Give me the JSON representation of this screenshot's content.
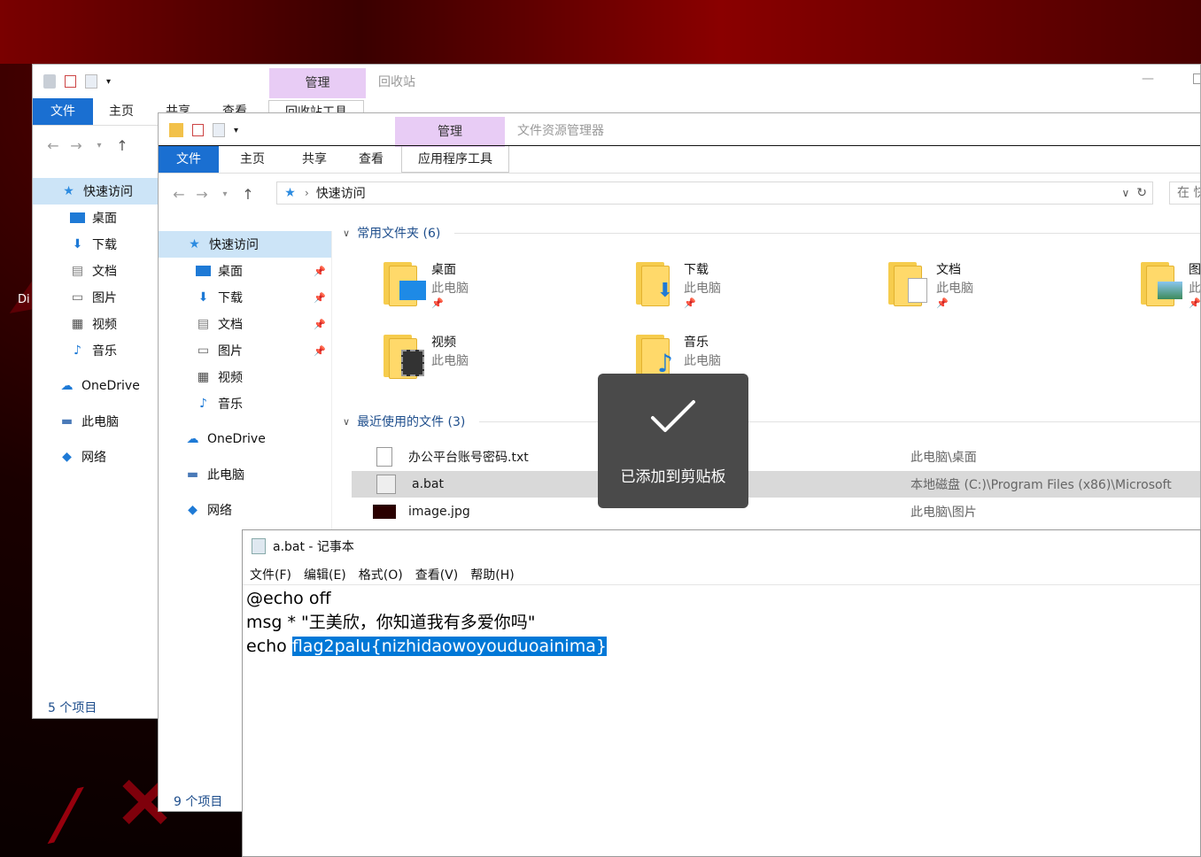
{
  "desktop": {
    "icon_label": "Di"
  },
  "back_window": {
    "context_tab": "管理",
    "title": "回收站",
    "tabs": [
      "文件",
      "主页",
      "共享",
      "查看"
    ],
    "context_sub_tab": "回收站工具",
    "nav": [
      "快速访问",
      "桌面",
      "下载",
      "文档",
      "图片",
      "视频",
      "音乐",
      "OneDrive",
      "此电脑",
      "网络"
    ],
    "status": "5 个项目"
  },
  "front_window": {
    "context_tab": "管理",
    "title": "文件资源管理器",
    "tabs": [
      "文件",
      "主页",
      "共享",
      "查看"
    ],
    "context_sub_tab": "应用程序工具",
    "address": "快速访问",
    "search_placeholder": "在 快",
    "nav": [
      "快速访问",
      "桌面",
      "下载",
      "文档",
      "图片",
      "视频",
      "音乐",
      "OneDrive",
      "此电脑",
      "网络"
    ],
    "frequent_header": "常用文件夹 (6)",
    "folders": [
      {
        "name": "桌面",
        "sub": "此电脑"
      },
      {
        "name": "下载",
        "sub": "此电脑"
      },
      {
        "name": "文档",
        "sub": "此电脑"
      },
      {
        "name": "图",
        "sub": "此"
      },
      {
        "name": "视频",
        "sub": "此电脑"
      },
      {
        "name": "音乐",
        "sub": "此电脑"
      }
    ],
    "recent_header": "最近使用的文件 (3)",
    "recent": [
      {
        "name": "办公平台账号密码.txt",
        "loc": "此电脑\\桌面"
      },
      {
        "name": "a.bat",
        "loc": "本地磁盘 (C:)\\Program Files (x86)\\Microsoft"
      },
      {
        "name": "image.jpg",
        "loc": "此电脑\\图片"
      }
    ],
    "status": "9 个项目"
  },
  "toast": {
    "message": "已添加到剪贴板"
  },
  "notepad": {
    "title": "a.bat - 记事本",
    "menu": [
      "文件(F)",
      "编辑(E)",
      "格式(O)",
      "查看(V)",
      "帮助(H)"
    ],
    "line1": "@echo off",
    "line2": "msg * \"王美欣，你知道我有多爱你吗\"",
    "line3_prefix": "echo ",
    "line3_selected": "flag2palu{nizhidaowoyouduoainima}"
  }
}
